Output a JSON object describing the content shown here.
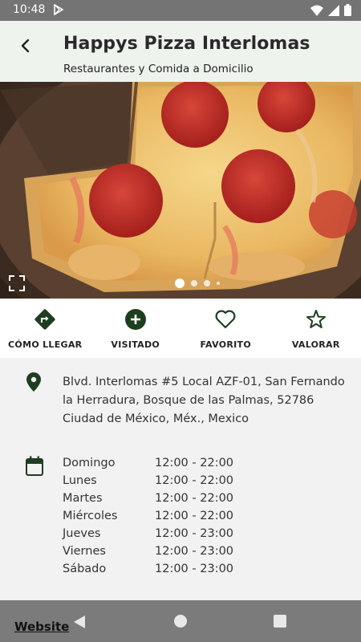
{
  "status_bar": {
    "time": "10:48"
  },
  "header": {
    "title": "Happys Pizza Interlomas",
    "subtitle": "Restaurantes y Comida a Domicilio"
  },
  "gallery": {
    "slide_count": 4,
    "active_slide": 1
  },
  "actions": [
    {
      "label": "CÓMO LLEGAR",
      "icon": "directions-icon"
    },
    {
      "label": "VISITADO",
      "icon": "add-circle-icon"
    },
    {
      "label": "FAVORITO",
      "icon": "heart-icon"
    },
    {
      "label": "VALORAR",
      "icon": "star-icon"
    }
  ],
  "address": "Blvd. Interlomas #5 Local AZF-01, San Fernando la Herradura, Bosque de las Palmas, 52786 Ciudad de México, Méx., Mexico",
  "hours": [
    {
      "day": "Domingo",
      "time": "12:00 - 22:00"
    },
    {
      "day": "Lunes",
      "time": "12:00 - 22:00"
    },
    {
      "day": "Martes",
      "time": "12:00 - 22:00"
    },
    {
      "day": "Miércoles",
      "time": "12:00 - 22:00"
    },
    {
      "day": "Jueves",
      "time": "12:00 - 23:00"
    },
    {
      "day": "Viernes",
      "time": "12:00 - 23:00"
    },
    {
      "day": "Sábado",
      "time": "12:00 - 23:00"
    }
  ],
  "footer": {
    "website_label": "Website"
  },
  "colors": {
    "accent": "#1f3d1f",
    "header_bg": "#eef3ee",
    "status_bar": "#747474"
  }
}
